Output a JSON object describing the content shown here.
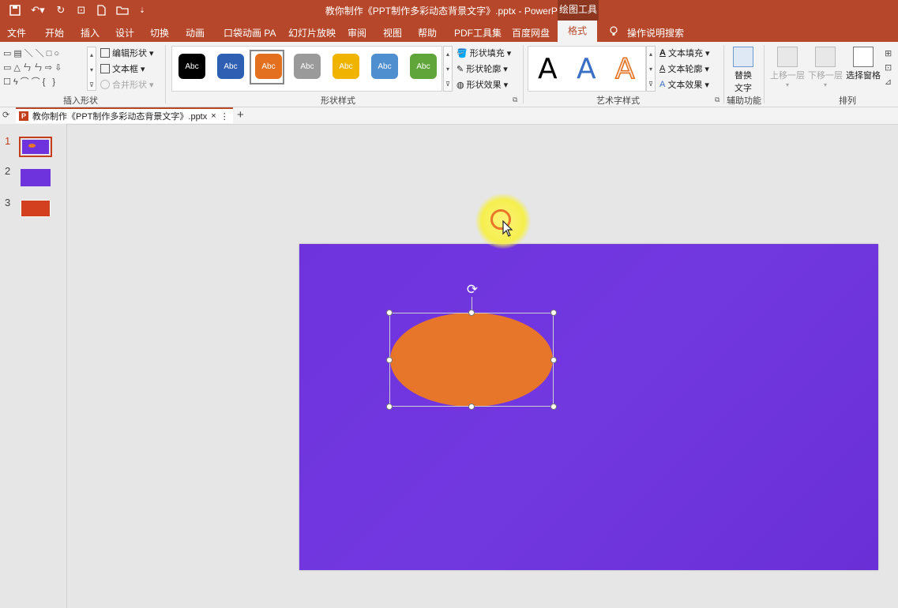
{
  "titlebar": {
    "title": "教你制作《PPT制作多彩动态背景文字》.pptx  -  PowerPoint",
    "context_tab": "绘图工具"
  },
  "tabs": [
    "文件",
    "开始",
    "插入",
    "设计",
    "切换",
    "动画",
    "口袋动画 PA",
    "幻灯片放映",
    "审阅",
    "视图",
    "帮助",
    "PDF工具集",
    "百度网盘",
    "格式"
  ],
  "active_tab": "格式",
  "tell_me": "操作说明搜索",
  "ribbon": {
    "insert_shapes": {
      "label": "插入形状",
      "edit_shape": "编辑形状",
      "text_box": "文本框",
      "merge_shapes": "合并形状"
    },
    "shape_styles": {
      "label": "形状样式",
      "swatches": [
        {
          "text": "Abc",
          "color": "#000000"
        },
        {
          "text": "Abc",
          "color": "#2f5fb3"
        },
        {
          "text": "Abc",
          "color": "#e2701f",
          "selected": true
        },
        {
          "text": "Abc",
          "color": "#9a9a9a"
        },
        {
          "text": "Abc",
          "color": "#f0b400"
        },
        {
          "text": "Abc",
          "color": "#4f8fd0"
        },
        {
          "text": "Abc",
          "color": "#5fa53a"
        }
      ],
      "fill": "形状填充",
      "outline": "形状轮廓",
      "effects": "形状效果"
    },
    "wordart": {
      "label": "艺术字样式",
      "samples": [
        {
          "text": "A",
          "color": "#000000"
        },
        {
          "text": "A",
          "color": "#3a6fc4"
        },
        {
          "text": "A",
          "color": "#f0a070"
        }
      ],
      "text_fill": "文本填充",
      "text_outline": "文本轮廓",
      "text_effects": "文本效果"
    },
    "accessibility": {
      "label": "辅助功能",
      "alt_text_line1": "替换",
      "alt_text_line2": "文字"
    },
    "arrange": {
      "label": "排列",
      "bring_forward": "上移一层",
      "send_backward": "下移一层",
      "selection_pane": "选择窗格"
    }
  },
  "document_tab": {
    "name": "教你制作《PPT制作多彩动态背景文字》.pptx",
    "close": "×",
    "more": "⋮",
    "add": "+"
  },
  "thumbnails": [
    {
      "number": "1",
      "color": "#6e33dc",
      "selected": true
    },
    {
      "number": "2",
      "color": "#6e33dc"
    },
    {
      "number": "3",
      "color": "#d2401f"
    }
  ],
  "colors": {
    "accent": "#b7472a",
    "slide_bg": "#6f33dd",
    "ellipse": "#e8762a"
  }
}
